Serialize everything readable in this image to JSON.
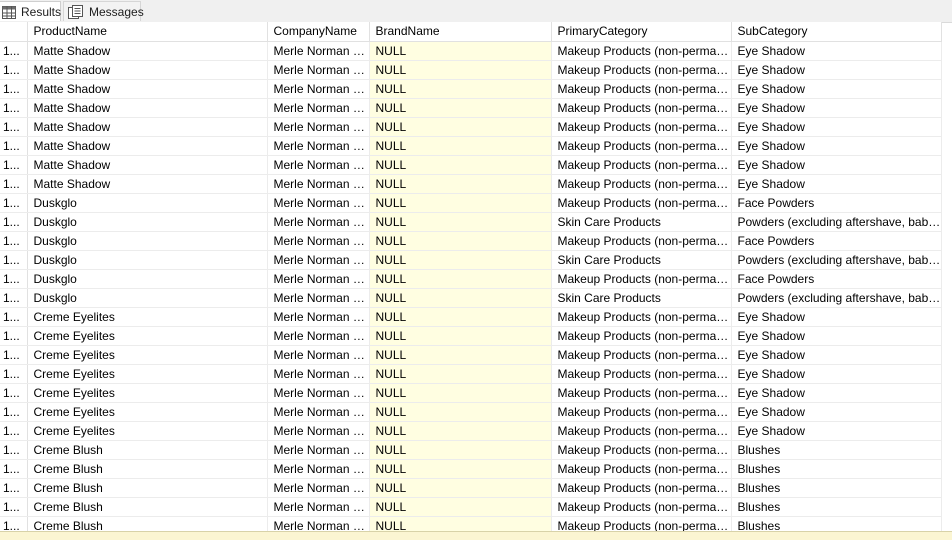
{
  "tabs": [
    {
      "label": "Results",
      "icon": "grid-icon",
      "active": true
    },
    {
      "label": "Messages",
      "icon": "messages-icon",
      "active": false
    }
  ],
  "columns": [
    "",
    "ProductName",
    "CompanyName",
    "BrandName",
    "PrimaryCategory",
    "SubCategory"
  ],
  "rows": [
    [
      "1...",
      "Matte Shadow",
      "Merle Norman C...",
      "NULL",
      "Makeup Products (non-permanent)",
      "Eye Shadow"
    ],
    [
      "1...",
      "Matte Shadow",
      "Merle Norman C...",
      "NULL",
      "Makeup Products (non-permanent)",
      "Eye Shadow"
    ],
    [
      "1...",
      "Matte Shadow",
      "Merle Norman C...",
      "NULL",
      "Makeup Products (non-permanent)",
      "Eye Shadow"
    ],
    [
      "1...",
      "Matte Shadow",
      "Merle Norman C...",
      "NULL",
      "Makeup Products (non-permanent)",
      "Eye Shadow"
    ],
    [
      "1...",
      "Matte Shadow",
      "Merle Norman C...",
      "NULL",
      "Makeup Products (non-permanent)",
      "Eye Shadow"
    ],
    [
      "1...",
      "Matte Shadow",
      "Merle Norman C...",
      "NULL",
      "Makeup Products (non-permanent)",
      "Eye Shadow"
    ],
    [
      "1...",
      "Matte Shadow",
      "Merle Norman C...",
      "NULL",
      "Makeup Products (non-permanent)",
      "Eye Shadow"
    ],
    [
      "1...",
      "Matte Shadow",
      "Merle Norman C...",
      "NULL",
      "Makeup Products (non-permanent)",
      "Eye Shadow"
    ],
    [
      "1...",
      "Duskglo",
      "Merle Norman C...",
      "NULL",
      "Makeup Products (non-permanent)",
      "Face Powders"
    ],
    [
      "1...",
      "Duskglo",
      "Merle Norman C...",
      "NULL",
      "Skin Care Products",
      "Powders (excluding aftershave, baby p..."
    ],
    [
      "1...",
      "Duskglo",
      "Merle Norman C...",
      "NULL",
      "Makeup Products (non-permanent)",
      "Face Powders"
    ],
    [
      "1...",
      "Duskglo",
      "Merle Norman C...",
      "NULL",
      "Skin Care Products",
      "Powders (excluding aftershave, baby p..."
    ],
    [
      "1...",
      "Duskglo",
      "Merle Norman C...",
      "NULL",
      "Makeup Products (non-permanent)",
      "Face Powders"
    ],
    [
      "1...",
      "Duskglo",
      "Merle Norman C...",
      "NULL",
      "Skin Care Products",
      "Powders (excluding aftershave, baby p..."
    ],
    [
      "1...",
      "Creme Eyelites",
      "Merle Norman C...",
      "NULL",
      "Makeup Products (non-permanent)",
      "Eye Shadow"
    ],
    [
      "1...",
      "Creme Eyelites",
      "Merle Norman C...",
      "NULL",
      "Makeup Products (non-permanent)",
      "Eye Shadow"
    ],
    [
      "1...",
      "Creme Eyelites",
      "Merle Norman C...",
      "NULL",
      "Makeup Products (non-permanent)",
      "Eye Shadow"
    ],
    [
      "1...",
      "Creme Eyelites",
      "Merle Norman C...",
      "NULL",
      "Makeup Products (non-permanent)",
      "Eye Shadow"
    ],
    [
      "1...",
      "Creme Eyelites",
      "Merle Norman C...",
      "NULL",
      "Makeup Products (non-permanent)",
      "Eye Shadow"
    ],
    [
      "1...",
      "Creme Eyelites",
      "Merle Norman C...",
      "NULL",
      "Makeup Products (non-permanent)",
      "Eye Shadow"
    ],
    [
      "1...",
      "Creme Eyelites",
      "Merle Norman C...",
      "NULL",
      "Makeup Products (non-permanent)",
      "Eye Shadow"
    ],
    [
      "1...",
      "Creme Blush",
      "Merle Norman C...",
      "NULL",
      "Makeup Products (non-permanent)",
      "Blushes"
    ],
    [
      "1...",
      "Creme Blush",
      "Merle Norman C...",
      "NULL",
      "Makeup Products (non-permanent)",
      "Blushes"
    ],
    [
      "1...",
      "Creme Blush",
      "Merle Norman C...",
      "NULL",
      "Makeup Products (non-permanent)",
      "Blushes"
    ],
    [
      "1...",
      "Creme Blush",
      "Merle Norman C...",
      "NULL",
      "Makeup Products (non-permanent)",
      "Blushes"
    ],
    [
      "1...",
      "Creme Blush",
      "Merle Norman C...",
      "NULL",
      "Makeup Products (non-permanent)",
      "Blushes"
    ]
  ],
  "colors": {
    "null_column_bg": "#fffee1",
    "grid_line": "#ececec",
    "tab_bar_bg": "#f0f0f0"
  }
}
